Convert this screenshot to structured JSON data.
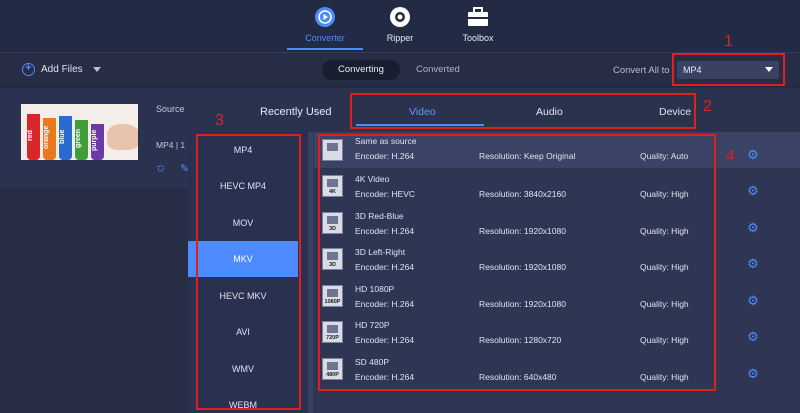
{
  "nav": {
    "items": [
      {
        "label": "Converter",
        "icon": "converter-icon",
        "active": true
      },
      {
        "label": "Ripper",
        "icon": "ripper-icon",
        "active": false
      },
      {
        "label": "Toolbox",
        "icon": "toolbox-icon",
        "active": false
      }
    ]
  },
  "toolbar": {
    "add_files": "Add Files",
    "seg_converting": "Converting",
    "seg_converted": "Converted",
    "convert_all_label": "Convert All to",
    "convert_all_value": "MP4"
  },
  "file": {
    "source_label": "Source",
    "meta": "MP4 | 1",
    "thumb_words": [
      "red",
      "orange",
      "blue",
      "green",
      "purple"
    ]
  },
  "panel": {
    "recent": "Recently Used",
    "tabs": [
      "Video",
      "Audio",
      "Device"
    ],
    "active_tab": "Video",
    "formats": [
      "MP4",
      "HEVC MP4",
      "MOV",
      "MKV",
      "HEVC MKV",
      "AVI",
      "WMV",
      "WEBM"
    ],
    "selected_format": "MKV",
    "presets": [
      {
        "name": "Same as source",
        "encoder": "Encoder: H.264",
        "resolution": "Resolution: Keep Original",
        "quality": "Quality: Auto",
        "badge": ""
      },
      {
        "name": "4K Video",
        "encoder": "Encoder: HEVC",
        "resolution": "Resolution: 3840x2160",
        "quality": "Quality: High",
        "badge": "4K"
      },
      {
        "name": "3D Red-Blue",
        "encoder": "Encoder: H.264",
        "resolution": "Resolution: 1920x1080",
        "quality": "Quality: High",
        "badge": "3D"
      },
      {
        "name": "3D Left-Right",
        "encoder": "Encoder: H.264",
        "resolution": "Resolution: 1920x1080",
        "quality": "Quality: High",
        "badge": "3D"
      },
      {
        "name": "HD 1080P",
        "encoder": "Encoder: H.264",
        "resolution": "Resolution: 1920x1080",
        "quality": "Quality: High",
        "badge": "1080P"
      },
      {
        "name": "HD 720P",
        "encoder": "Encoder: H.264",
        "resolution": "Resolution: 1280x720",
        "quality": "Quality: High",
        "badge": "720P"
      },
      {
        "name": "SD 480P",
        "encoder": "Encoder: H.264",
        "resolution": "Resolution: 640x480",
        "quality": "Quality: High",
        "badge": "480P"
      }
    ]
  },
  "annotations": [
    "1",
    "2",
    "3",
    "4"
  ],
  "colors": {
    "accent": "#4d8cff",
    "annotation": "#e02020",
    "background": "#262d45"
  }
}
